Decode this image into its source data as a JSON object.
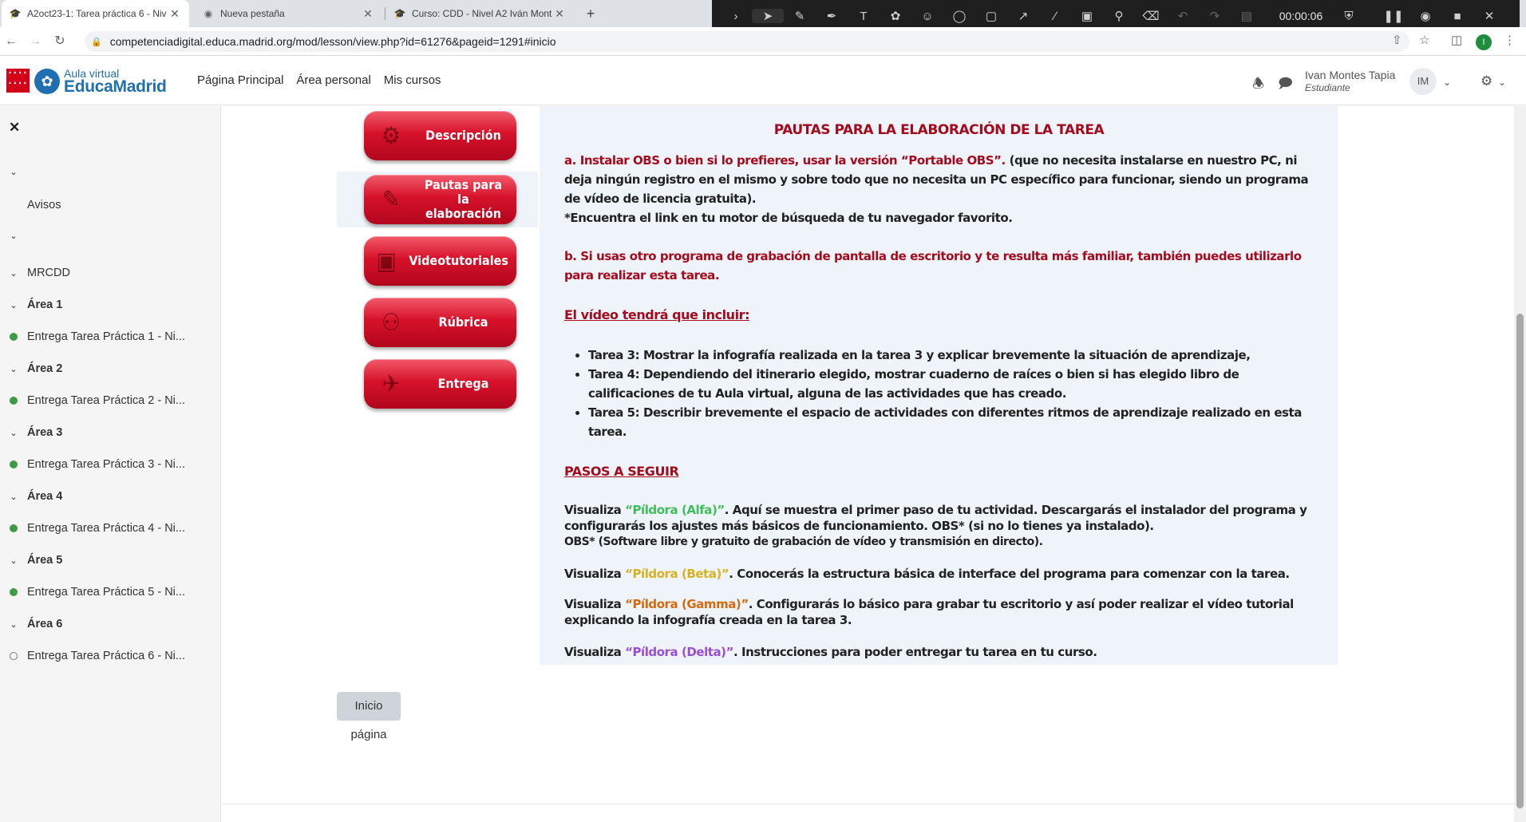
{
  "browser": {
    "tabs": [
      {
        "title": "A2oct23-1: Tarea práctica 6 - Niv"
      },
      {
        "title": "Nueva pestaña"
      },
      {
        "title": "Curso: CDD - Nivel A2 Iván Mont"
      }
    ],
    "url": "competenciadigital.educa.madrid.org/mod/lesson/view.php?id=61276&pageid=1291#inicio",
    "profile_initial": "I"
  },
  "recorder": {
    "timer": "00:00:06"
  },
  "header": {
    "logo_sub": "Aula virtual",
    "logo_main": "EducaMadrid",
    "nav": [
      "Página Principal",
      "Área personal",
      "Mis cursos"
    ],
    "user_name": "Ivan Montes Tapia",
    "user_role": "Estudiante",
    "avatar_initials": "IM"
  },
  "sidebar": {
    "avisos": "Avisos",
    "items": [
      {
        "type": "section",
        "label": "MRCDD"
      },
      {
        "type": "section",
        "label": "Área 1"
      },
      {
        "type": "activity",
        "label": "Entrega Tarea Práctica 1 - Ni...",
        "done": true
      },
      {
        "type": "section",
        "label": "Área 2"
      },
      {
        "type": "activity",
        "label": "Entrega Tarea Práctica 2 - Ni...",
        "done": true
      },
      {
        "type": "section",
        "label": "Área 3"
      },
      {
        "type": "activity",
        "label": "Entrega Tarea Práctica 3 - Ni...",
        "done": true
      },
      {
        "type": "section",
        "label": "Área 4"
      },
      {
        "type": "activity",
        "label": "Entrega Tarea Práctica 4 - Ni...",
        "done": true
      },
      {
        "type": "section",
        "label": "Área 5"
      },
      {
        "type": "activity",
        "label": "Entrega Tarea Práctica 5 - Ni...",
        "done": true
      },
      {
        "type": "section",
        "label": "Área 6"
      },
      {
        "type": "activity",
        "label": "Entrega Tarea Práctica 6 - Ni...",
        "done": false
      }
    ]
  },
  "menu": [
    {
      "label": "Descripción",
      "icon": "gear-cogs-icon"
    },
    {
      "label": "Pautas para la elaboración",
      "icon": "checklist-pen-icon"
    },
    {
      "label": "Videotutoriales",
      "icon": "monitor-video-icon"
    },
    {
      "label": "Rúbrica",
      "icon": "teacher-board-icon"
    },
    {
      "label": "Entrega",
      "icon": "delivery-runner-icon"
    }
  ],
  "content": {
    "title": "PAUTAS PARA LA ELABORACIÓN DE LA TAREA",
    "a_red": "a. Instalar OBS o bien si lo prefieres, usar la versión “Portable OBS”.",
    "a_rest": " (que no necesita instalarse en nuestro PC, ni deja ningún registro en el mismo y sobre todo que no necesita un PC específico para funcionar, siendo un programa de vídeo de licencia gratuita).",
    "a_note": "*Encuentra el link en tu motor de búsqueda de tu navegador favorito.",
    "b_red": "b. Si usas otro programa de grabación de pantalla de escritorio y te resulta más familiar, también puedes utilizarlo para realizar esta tarea.",
    "video_heading": "El vídeo tendrá que incluir:",
    "bullets": [
      "Tarea 3: Mostrar la infografía realizada en la tarea 3 y explicar brevemente la situación de aprendizaje,",
      "Tarea 4: Dependiendo del itinerario elegido, mostrar cuaderno de raíces o bien si has elegido libro de calificaciones de tu Aula virtual, alguna de las actividades que has creado.",
      "Tarea 5: Describir brevemente el espacio de actividades con diferentes ritmos de aprendizaje realizado en esta tarea."
    ],
    "steps_heading": "PASOS A SEGUIR",
    "steps": [
      {
        "prefix": "Visualiza ",
        "pill": "“Píldora (Alfa)”",
        "text": ". Aquí se muestra el primer paso de tu actividad. Descargarás el instalador del programa y configurarás los ajustes más básicos de funcionamiento. OBS* (si no lo tienes ya instalado)."
      },
      {
        "prefix": "Visualiza ",
        "pill": "“Píldora (Beta)”",
        "text": ". Conocerás la estructura básica de interface del programa para comenzar con la tarea."
      },
      {
        "prefix": "Visualiza ",
        "pill": "“Píldora (Gamma)”",
        "text": ". Configurarás lo básico para grabar tu escritorio y así poder realizar el vídeo tutorial explicando la infografía creada en la tarea 3."
      },
      {
        "prefix": "Visualiza ",
        "pill": "“Píldora (Delta)”",
        "text": ". Instrucciones para poder entregar tu tarea en tu curso."
      }
    ],
    "obs_note": "OBS* (Software libre y gratuito de grabación de vídeo y transmisión en directo).",
    "home_button": "Inicio página"
  },
  "colors": {
    "accent_red": "#a40c1e",
    "alfa": "#3fbf5a",
    "beta": "#d7b221",
    "gamma": "#d46a0f",
    "delta": "#9a4fd1",
    "brand_blue": "#1f6fb2"
  }
}
